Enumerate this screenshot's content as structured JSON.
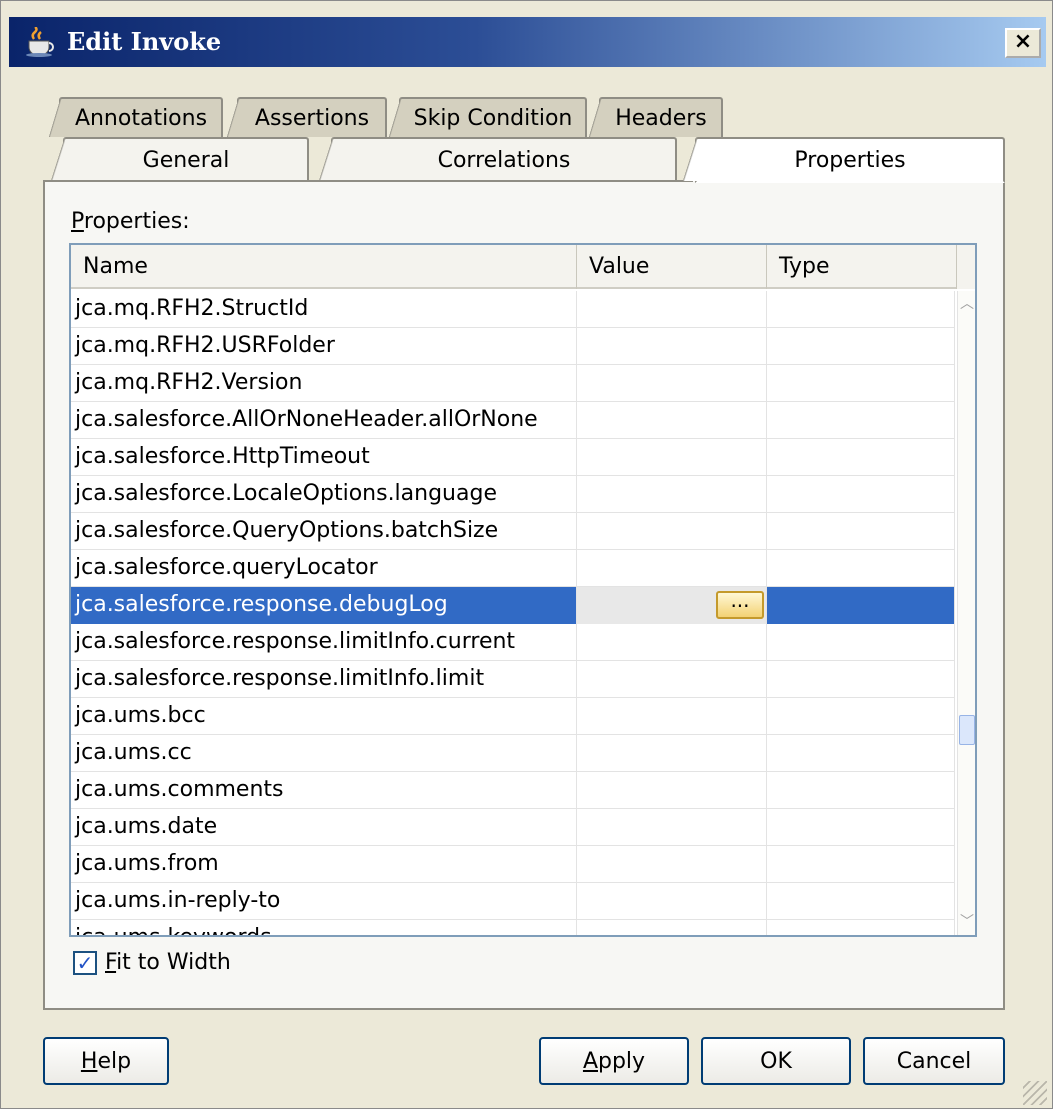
{
  "window": {
    "title": "Edit Invoke",
    "close_label": "×"
  },
  "tabs": {
    "back_row": [
      "Annotations",
      "Assertions",
      "Skip Condition",
      "Headers"
    ],
    "front_row": [
      "General",
      "Correlations",
      "Properties"
    ],
    "active": "Properties"
  },
  "properties": {
    "label_prefix": "P",
    "label_rest": "roperties:",
    "columns": [
      "Name",
      "Value",
      "Type"
    ],
    "rows": [
      {
        "name": "jca.mq.RFH2.StructId",
        "value": "",
        "type": ""
      },
      {
        "name": "jca.mq.RFH2.USRFolder",
        "value": "",
        "type": ""
      },
      {
        "name": "jca.mq.RFH2.Version",
        "value": "",
        "type": ""
      },
      {
        "name": "jca.salesforce.AllOrNoneHeader.allOrNone",
        "value": "",
        "type": ""
      },
      {
        "name": "jca.salesforce.HttpTimeout",
        "value": "",
        "type": ""
      },
      {
        "name": "jca.salesforce.LocaleOptions.language",
        "value": "",
        "type": ""
      },
      {
        "name": "jca.salesforce.QueryOptions.batchSize",
        "value": "",
        "type": ""
      },
      {
        "name": "jca.salesforce.queryLocator",
        "value": "",
        "type": ""
      },
      {
        "name": "jca.salesforce.response.debugLog",
        "value": "",
        "type": "",
        "selected": true
      },
      {
        "name": "jca.salesforce.response.limitInfo.current",
        "value": "",
        "type": ""
      },
      {
        "name": "jca.salesforce.response.limitInfo.limit",
        "value": "",
        "type": ""
      },
      {
        "name": "jca.ums.bcc",
        "value": "",
        "type": ""
      },
      {
        "name": "jca.ums.cc",
        "value": "",
        "type": ""
      },
      {
        "name": "jca.ums.comments",
        "value": "",
        "type": ""
      },
      {
        "name": "jca.ums.date",
        "value": "",
        "type": ""
      },
      {
        "name": "jca.ums.from",
        "value": "",
        "type": ""
      },
      {
        "name": "jca.ums.in-reply-to",
        "value": "",
        "type": ""
      },
      {
        "name": "jca.ums.keywords",
        "value": "",
        "type": ""
      }
    ],
    "ellipsis_label": "...",
    "selected_color": "#316ac5"
  },
  "fit_to_width": {
    "checked": true,
    "check_mark": "✓",
    "label_prefix": "F",
    "label_rest": "it to Width"
  },
  "buttons": {
    "help_prefix": "H",
    "help_rest": "elp",
    "apply_prefix": "A",
    "apply_rest": "pply",
    "ok": "OK",
    "cancel": "Cancel"
  },
  "icons": {
    "title": "coffee-cup-icon",
    "scroll_up": "chevron-up-icon",
    "scroll_down": "chevron-down-icon"
  },
  "colors": {
    "title_bar_start": "#0a246a",
    "title_bar_end": "#a6caf0",
    "dialog_bg": "#ece9d8"
  }
}
